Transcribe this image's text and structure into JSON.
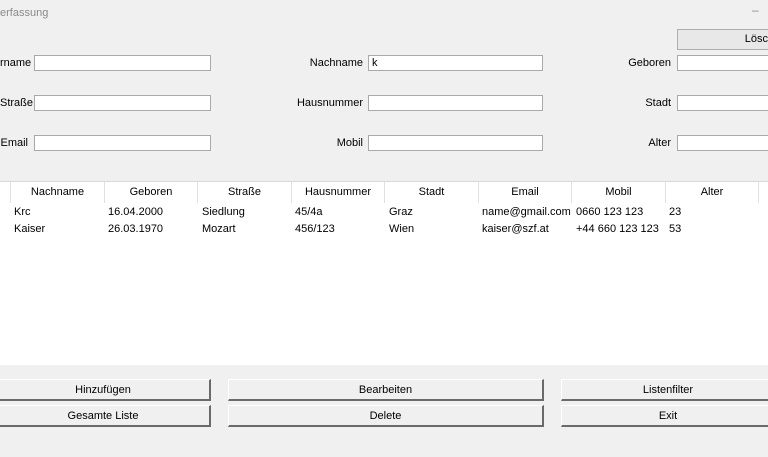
{
  "window": {
    "title": "erfassung",
    "minimize_glyph": "–"
  },
  "form": {
    "vorname_label": "rname",
    "vorname_value": "",
    "nachname_label": "Nachname",
    "nachname_value": "k",
    "geboren_label": "Geboren",
    "geboren_value": "",
    "strasse_label": "Straße",
    "strasse_value": "",
    "hausnummer_label": "Hausnummer",
    "hausnummer_value": "",
    "stadt_label": "Stadt",
    "stadt_value": "",
    "email_label": "Email",
    "email_value": "",
    "mobil_label": "Mobil",
    "mobil_value": "",
    "alter_label": "Alter",
    "alter_value": "",
    "loeschen_label": "Lösc"
  },
  "table": {
    "columns": [
      "Nachname",
      "Geboren",
      "Straße",
      "Hausnummer",
      "Stadt",
      "Email",
      "Mobil",
      "Alter"
    ],
    "rows": [
      [
        "Krc",
        "16.04.2000",
        "Siedlung",
        "45/4a",
        "Graz",
        "name@gmail.com",
        "0660 123 123",
        "23"
      ],
      [
        "Kaiser",
        "26.03.1970",
        "Mozart",
        "456/123",
        "Wien",
        "kaiser@szf.at",
        "+44 660 123 123",
        "53"
      ]
    ]
  },
  "buttons": {
    "hinzufuegen": "Hinzufügen",
    "bearbeiten": "Bearbeiten",
    "listenfilter": "Listenfilter",
    "gesamte_liste": "Gesamte Liste",
    "delete": "Delete",
    "exit": "Exit"
  }
}
